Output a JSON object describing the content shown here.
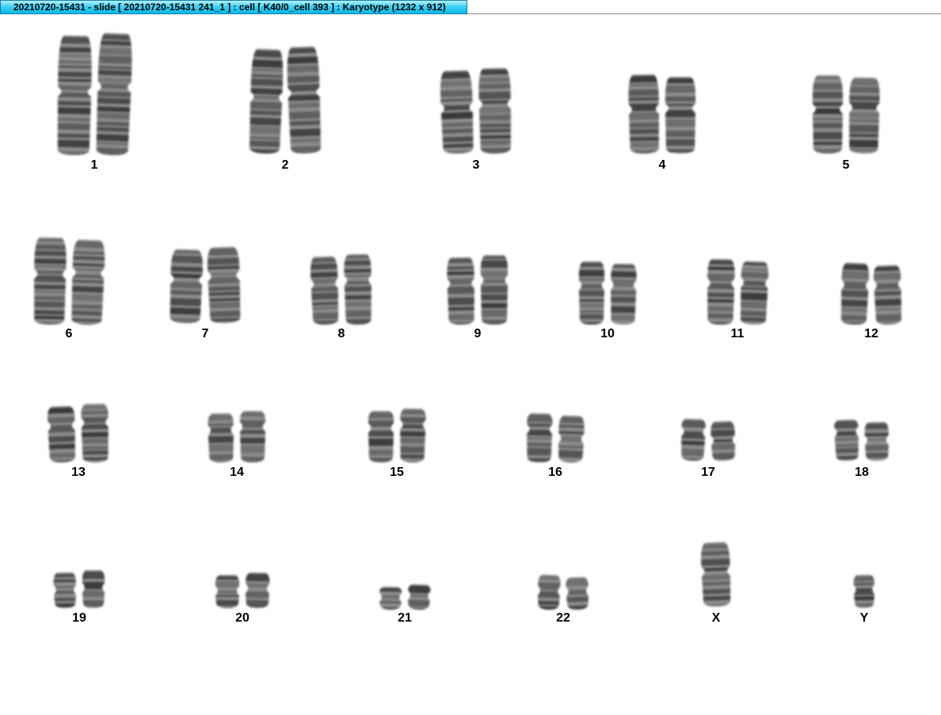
{
  "window": {
    "title": "20210720-15431 - slide [ 20210720-15431 241_1 ] : cell [ K40/0_cell 393 ] : Karyotype  (1232 x 912)"
  },
  "colors": {
    "titlebar_accent": "#09b7e8",
    "chromosome_dark": "#2a2a2a",
    "chromosome_light": "#8c8c8c",
    "background": "#ffffff"
  },
  "karyotype": {
    "rows": [
      {
        "pairs": [
          {
            "label": "1",
            "count": 2
          },
          {
            "label": "2",
            "count": 2
          },
          {
            "label": "3",
            "count": 2
          },
          {
            "label": "4",
            "count": 2
          },
          {
            "label": "5",
            "count": 2
          }
        ]
      },
      {
        "pairs": [
          {
            "label": "6",
            "count": 2
          },
          {
            "label": "7",
            "count": 2
          },
          {
            "label": "8",
            "count": 2
          },
          {
            "label": "9",
            "count": 2
          },
          {
            "label": "10",
            "count": 2
          },
          {
            "label": "11",
            "count": 2
          },
          {
            "label": "12",
            "count": 2
          }
        ]
      },
      {
        "pairs": [
          {
            "label": "13",
            "count": 2
          },
          {
            "label": "14",
            "count": 2
          },
          {
            "label": "15",
            "count": 2
          },
          {
            "label": "16",
            "count": 2
          },
          {
            "label": "17",
            "count": 2
          },
          {
            "label": "18",
            "count": 2
          }
        ]
      },
      {
        "pairs": [
          {
            "label": "19",
            "count": 2
          },
          {
            "label": "20",
            "count": 2
          },
          {
            "label": "21",
            "count": 2
          },
          {
            "label": "22",
            "count": 2
          },
          {
            "label": "X",
            "count": 1
          },
          {
            "label": "Y",
            "count": 1
          }
        ]
      }
    ]
  }
}
